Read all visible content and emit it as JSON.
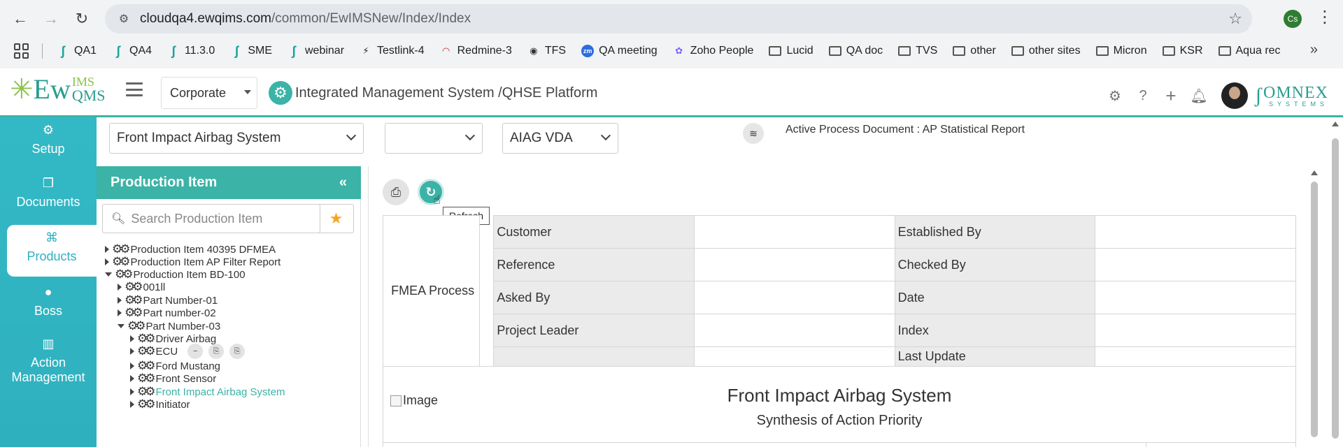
{
  "browser": {
    "url_host": "cloudqa4.ewqims.com",
    "url_path": "/common/EwIMSNew/Index/Index",
    "profile_initials": "Cs"
  },
  "bookmarks": [
    {
      "label": "QA1",
      "icon": "ew"
    },
    {
      "label": "QA4",
      "icon": "ew"
    },
    {
      "label": "11.3.0",
      "icon": "ew"
    },
    {
      "label": "SME",
      "icon": "ew"
    },
    {
      "label": "webinar",
      "icon": "ew"
    },
    {
      "label": "Testlink-4",
      "icon": "testlink"
    },
    {
      "label": "Redmine-3",
      "icon": "redmine"
    },
    {
      "label": "TFS",
      "icon": "globe"
    },
    {
      "label": "QA meeting",
      "icon": "zoom"
    },
    {
      "label": "Zoho People",
      "icon": "zoho"
    },
    {
      "label": "Lucid",
      "icon": "folder"
    },
    {
      "label": "QA doc",
      "icon": "folder"
    },
    {
      "label": "TVS",
      "icon": "folder"
    },
    {
      "label": "other",
      "icon": "folder"
    },
    {
      "label": "other sites",
      "icon": "folder"
    },
    {
      "label": "Micron",
      "icon": "folder"
    },
    {
      "label": "KSR",
      "icon": "folder"
    },
    {
      "label": "Aqua rec",
      "icon": "folder"
    }
  ],
  "app": {
    "logo_ew": "Ew",
    "logo_ims": "IMS",
    "logo_qms": "QMS",
    "corporate_select": "Corporate",
    "platform_title": "Integrated Management System /QHSE Platform",
    "brand": "OMNEX",
    "brand_sub": "SYSTEMS"
  },
  "leftnav": [
    {
      "label": "Setup",
      "icon": "gears-icon"
    },
    {
      "label": "Documents",
      "icon": "documents-icon"
    },
    {
      "label": "Products",
      "icon": "products-icon",
      "active": true
    },
    {
      "label": "Boss",
      "icon": "user-icon"
    },
    {
      "label": "Action",
      "label2": "Management",
      "icon": "building-icon"
    }
  ],
  "filters": {
    "product": "Front Impact Airbag System",
    "second": "",
    "standard": "AIAG VDA",
    "active_doc": "Active Process Document : AP Statistical Report"
  },
  "production_panel": {
    "title": "Production Item",
    "search_placeholder": "Search Production Item",
    "tree": [
      {
        "label": "Production Item 40395 DFMEA",
        "level": 0,
        "state": "collapsed"
      },
      {
        "label": "Production Item AP Filter Report",
        "level": 0,
        "state": "collapsed"
      },
      {
        "label": "Production Item BD-100",
        "level": 0,
        "state": "expanded"
      },
      {
        "label": "001ll",
        "level": 1,
        "state": "collapsed"
      },
      {
        "label": "Part Number-01",
        "level": 1,
        "state": "collapsed"
      },
      {
        "label": "Part number-02",
        "level": 1,
        "state": "collapsed"
      },
      {
        "label": "Part Number-03",
        "level": 1,
        "state": "expanded"
      },
      {
        "label": "Driver Airbag",
        "level": 2,
        "state": "collapsed"
      },
      {
        "label": "ECU",
        "level": 2,
        "state": "collapsed",
        "actions": true
      },
      {
        "label": "Ford Mustang",
        "level": 2,
        "state": "collapsed"
      },
      {
        "label": "Front Sensor",
        "level": 2,
        "state": "collapsed"
      },
      {
        "label": "Front Impact Airbag System",
        "level": 2,
        "state": "collapsed",
        "selected": true
      },
      {
        "label": "Initiator",
        "level": 2,
        "state": "collapsed"
      }
    ]
  },
  "main": {
    "tooltip": "Refresh",
    "fmea_process": "FMEA Process",
    "rows": [
      {
        "l1": "Customer",
        "v1": "",
        "l2": "Established By",
        "v2": ""
      },
      {
        "l1": "Reference",
        "v1": "",
        "l2": "Checked By",
        "v2": ""
      },
      {
        "l1": "Asked By",
        "v1": "",
        "l2": "Date",
        "v2": ""
      },
      {
        "l1": "Project Leader",
        "v1": "",
        "l2": "Index",
        "v2": ""
      },
      {
        "l1": "",
        "v1": "",
        "l2": "Last Update",
        "v2": ""
      }
    ],
    "image_alt": "Image",
    "report_title": "Front Impact Airbag System",
    "report_subtitle": "Synthesis of Action Priority"
  }
}
